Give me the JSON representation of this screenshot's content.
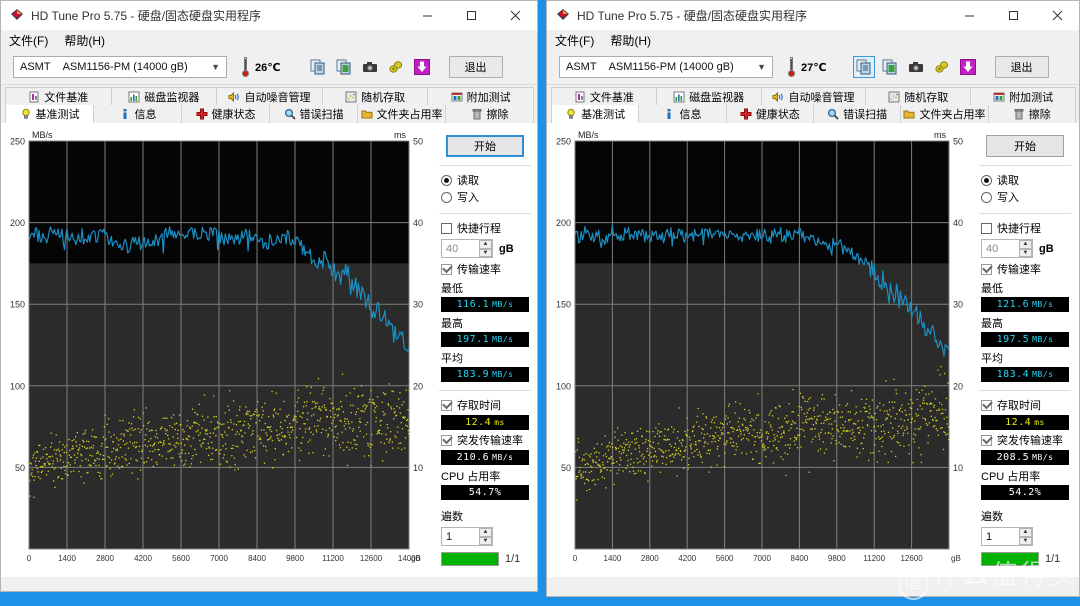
{
  "watermark": "什么值得买",
  "windows": [
    {
      "id": "left",
      "title": "HD Tune Pro 5.75 - 硬盘/固态硬盘实用程序",
      "menu": [
        "文件(F)",
        "帮助(H)"
      ],
      "device": {
        "vendor": "ASMT",
        "model": "ASM1156-PM (14000 gB)"
      },
      "temperature": "26℃",
      "exit_label": "退出",
      "toolbar_icons": [
        "copy-icon",
        "copy-disk-icon",
        "camera-icon",
        "tag-icon",
        "download-icon"
      ],
      "tabs_row1": [
        {
          "label": "文件基准",
          "icon": "file-benchmark-icon",
          "active": false
        },
        {
          "label": "磁盘监视器",
          "icon": "disk-monitor-icon",
          "active": false
        },
        {
          "label": "自动噪音管理",
          "icon": "speaker-icon",
          "active": false
        },
        {
          "label": "随机存取",
          "icon": "random-access-icon",
          "active": false
        },
        {
          "label": "附加测试",
          "icon": "extra-tests-icon",
          "active": false
        }
      ],
      "tabs_row2": [
        {
          "label": "基准测试",
          "icon": "bulb-icon",
          "active": true
        },
        {
          "label": "信息",
          "icon": "info-icon",
          "active": false
        },
        {
          "label": "健康状态",
          "icon": "health-icon",
          "active": false
        },
        {
          "label": "错误扫描",
          "icon": "magnifier-icon",
          "active": false
        },
        {
          "label": "文件夹占用率",
          "icon": "folder-icon",
          "active": false
        },
        {
          "label": "擦除",
          "icon": "trash-icon",
          "active": false
        }
      ],
      "panel": {
        "start_label": "开始",
        "start_focused": true,
        "read_label": "读取",
        "write_label": "写入",
        "mode_selected": "读取",
        "quick_label": "快捷行程",
        "quick_checked": false,
        "quick_value": "40",
        "quick_unit": "gB",
        "transfer_label": "传输速率",
        "transfer_checked": true,
        "min_label": "最低",
        "min_value": "116.1",
        "min_unit": "MB/s",
        "max_label": "最高",
        "max_value": "197.1",
        "max_unit": "MB/s",
        "avg_label": "平均",
        "avg_value": "183.9",
        "avg_unit": "MB/s",
        "access_label": "存取时间",
        "access_checked": true,
        "access_value": "12.4",
        "access_unit": "ms",
        "burst_label": "突发传输速率",
        "burst_checked": true,
        "burst_value": "210.6",
        "burst_unit": "MB/s",
        "cpu_label": "CPU 占用率",
        "cpu_value": "54.7%",
        "passes_label": "遍数",
        "passes_value": "1",
        "progress_text": "1/1",
        "progress_pct": 100
      },
      "chart_data": {
        "type": "line",
        "title": "",
        "ylabel": "MB/s",
        "y2label": "ms",
        "xlabel": "gB",
        "ylim": [
          0,
          250
        ],
        "y2lim": [
          0,
          50
        ],
        "xlim": [
          0,
          14000
        ],
        "grid": true,
        "yticks": [
          50,
          100,
          150,
          200,
          250
        ],
        "y2ticks": [
          10,
          20,
          30,
          40,
          50
        ],
        "xticks": [
          0,
          1400,
          2800,
          4200,
          5600,
          7000,
          8400,
          9800,
          11200,
          12600,
          14000
        ],
        "series": [
          {
            "name": "transfer-rate",
            "kind": "line",
            "color": "#1a8fc4",
            "axis": "left",
            "x": [
              0,
              280,
              560,
              840,
              1120,
              1400,
              1680,
              1960,
              2240,
              2520,
              2800,
              3080,
              3360,
              3640,
              3920,
              4200,
              4480,
              4760,
              5040,
              5320,
              5600,
              5880,
              6160,
              6440,
              6720,
              7000,
              7280,
              7560,
              7840,
              8120,
              8400,
              8680,
              8960,
              9240,
              9520,
              9800,
              10080,
              10360,
              10640,
              10920,
              11200,
              11480,
              11760,
              12040,
              12320,
              12600,
              12880,
              13160,
              13440,
              13720,
              14000
            ],
            "y": [
              190,
              193,
              191,
              194,
              192,
              193,
              191,
              192,
              190,
              191,
              192,
              190,
              188,
              186,
              189,
              187,
              190,
              188,
              192,
              194,
              193,
              195,
              193,
              194,
              193,
              192,
              190,
              188,
              193,
              191,
              190,
              186,
              190,
              192,
              191,
              189,
              185,
              180,
              176,
              182,
              170,
              166,
              172,
              160,
              155,
              150,
              146,
              140,
              133,
              128,
              123
            ]
          },
          {
            "name": "access-time",
            "kind": "scatter",
            "color": "#d2d21e",
            "axis": "right",
            "mean": 12.4
          }
        ]
      }
    },
    {
      "id": "right",
      "title": "HD Tune Pro 5.75 - 硬盘/固态硬盘实用程序",
      "menu": [
        "文件(F)",
        "帮助(H)"
      ],
      "device": {
        "vendor": "ASMT",
        "model": "ASM1156-PM (14000 gB)"
      },
      "temperature": "27℃",
      "exit_label": "退出",
      "toolbar_icons": [
        "copy-icon",
        "copy-disk-icon",
        "camera-icon",
        "tag-icon",
        "download-icon"
      ],
      "tabs_row1": [
        {
          "label": "文件基准",
          "icon": "file-benchmark-icon",
          "active": false
        },
        {
          "label": "磁盘监视器",
          "icon": "disk-monitor-icon",
          "active": false
        },
        {
          "label": "自动噪音管理",
          "icon": "speaker-icon",
          "active": false
        },
        {
          "label": "随机存取",
          "icon": "random-access-icon",
          "active": false
        },
        {
          "label": "附加测试",
          "icon": "extra-tests-icon",
          "active": false
        }
      ],
      "tabs_row2": [
        {
          "label": "基准测试",
          "icon": "bulb-icon",
          "active": true
        },
        {
          "label": "信息",
          "icon": "info-icon",
          "active": false
        },
        {
          "label": "健康状态",
          "icon": "health-icon",
          "active": false
        },
        {
          "label": "错误扫描",
          "icon": "magnifier-icon",
          "active": false
        },
        {
          "label": "文件夹占用率",
          "icon": "folder-icon",
          "active": false
        },
        {
          "label": "擦除",
          "icon": "trash-icon",
          "active": false
        }
      ],
      "panel": {
        "start_label": "开始",
        "start_focused": false,
        "read_label": "读取",
        "write_label": "写入",
        "mode_selected": "读取",
        "quick_label": "快捷行程",
        "quick_checked": false,
        "quick_value": "40",
        "quick_unit": "gB",
        "transfer_label": "传输速率",
        "transfer_checked": true,
        "min_label": "最低",
        "min_value": "121.6",
        "min_unit": "MB/s",
        "max_label": "最高",
        "max_value": "197.5",
        "max_unit": "MB/s",
        "avg_label": "平均",
        "avg_value": "183.4",
        "avg_unit": "MB/s",
        "access_label": "存取时间",
        "access_checked": true,
        "access_value": "12.4",
        "access_unit": "ms",
        "burst_label": "突发传输速率",
        "burst_checked": true,
        "burst_value": "208.5",
        "burst_unit": "MB/s",
        "cpu_label": "CPU 占用率",
        "cpu_value": "54.2%",
        "passes_label": "遍数",
        "passes_value": "1",
        "progress_text": "1/1",
        "progress_pct": 100
      },
      "chart_data": {
        "type": "line",
        "title": "",
        "ylabel": "MB/s",
        "y2label": "ms",
        "xlabel": "gB",
        "ylim": [
          0,
          250
        ],
        "y2lim": [
          0,
          50
        ],
        "xlim": [
          0,
          14000
        ],
        "grid": true,
        "yticks": [
          50,
          100,
          150,
          200,
          250
        ],
        "y2ticks": [
          10,
          20,
          30,
          40,
          50
        ],
        "xticks": [
          0,
          1400,
          2800,
          4200,
          5600,
          7000,
          8400,
          9800,
          11200,
          12600
        ],
        "series": [
          {
            "name": "transfer-rate",
            "kind": "line",
            "color": "#1a8fc4",
            "axis": "left",
            "x": [
              0,
              280,
              560,
              840,
              1120,
              1400,
              1680,
              1960,
              2240,
              2520,
              2800,
              3080,
              3360,
              3640,
              3920,
              4200,
              4480,
              4760,
              5040,
              5320,
              5600,
              5880,
              6160,
              6440,
              6720,
              7000,
              7280,
              7560,
              7840,
              8120,
              8400,
              8680,
              8960,
              9240,
              9520,
              9800,
              10080,
              10360,
              10640,
              10920,
              11200,
              11480,
              11760,
              12040,
              12320,
              12600,
              12880,
              13160,
              13440,
              13720,
              14000
            ],
            "y": [
              190,
              194,
              192,
              193,
              191,
              194,
              192,
              193,
              191,
              192,
              190,
              193,
              191,
              194,
              192,
              191,
              193,
              195,
              192,
              194,
              193,
              195,
              192,
              194,
              192,
              193,
              191,
              194,
              192,
              190,
              193,
              191,
              189,
              187,
              186,
              190,
              184,
              180,
              176,
              178,
              170,
              165,
              160,
              156,
              150,
              146,
              141,
              136,
              130,
              126,
              122
            ]
          },
          {
            "name": "access-time",
            "kind": "scatter",
            "color": "#d2d21e",
            "axis": "right",
            "mean": 12.4
          }
        ]
      }
    }
  ]
}
